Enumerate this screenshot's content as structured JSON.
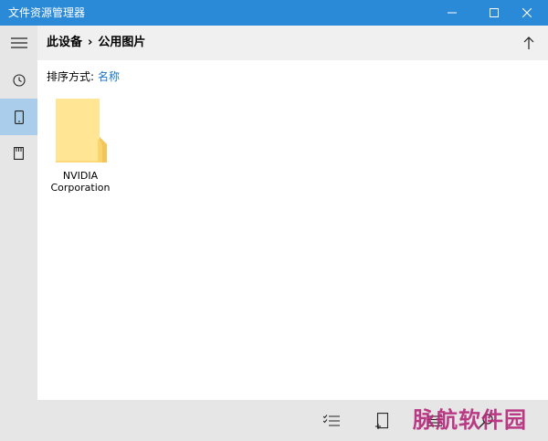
{
  "window": {
    "title": "文件资源管理器"
  },
  "header": {
    "breadcrumb": [
      "此设备",
      "公用图片"
    ],
    "separator": "›"
  },
  "sort": {
    "label": "排序方式:",
    "value": "名称"
  },
  "files": [
    {
      "name_line1": "NVIDIA",
      "name_line2": "Corporation",
      "icon": "folder-icon"
    }
  ],
  "sidebar": {
    "items": [
      {
        "icon": "hamburger-menu-icon"
      },
      {
        "icon": "clock-icon"
      },
      {
        "icon": "phone-icon",
        "active": true
      },
      {
        "icon": "sd-card-icon"
      }
    ]
  },
  "bottombar": {
    "icons": [
      "select-checklist-icon",
      "new-folder-icon",
      "list-view-icon",
      "search-icon"
    ]
  },
  "watermark": "脉航软件园",
  "colors": {
    "titlebar": "#2b8ad8",
    "accent": "#1a74c9",
    "active_item": "#a9cdea",
    "folder": "#fcd97a"
  }
}
